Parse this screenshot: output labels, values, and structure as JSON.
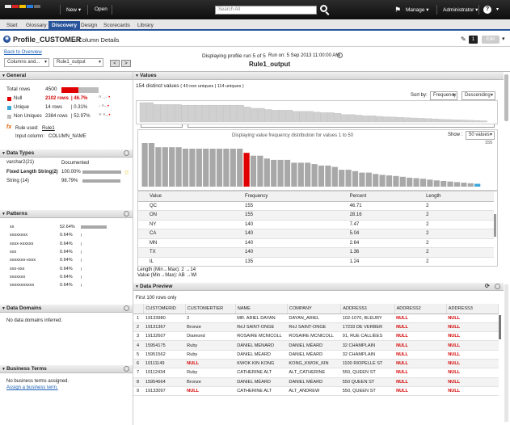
{
  "topbar": {
    "new_label": "New",
    "open_label": "Open",
    "search_placeholder": "Search All",
    "manage_label": "Manage",
    "user_label": "Administrator",
    "help_label": "?"
  },
  "tabs": [
    {
      "label": "Start"
    },
    {
      "label": "Glossary"
    },
    {
      "label": "Discovery"
    },
    {
      "label": "Design"
    },
    {
      "label": "Scorecards"
    },
    {
      "label": "Library"
    }
  ],
  "header": {
    "title": "Profile_CUSTOMER",
    "subtitle": "- Column Details",
    "badge": "1",
    "edit_label": "Edit"
  },
  "toolbar": {
    "back_link": "Back to Overview",
    "columns_select": "Columns and...",
    "column_select": "Rule1_output",
    "prev": "<",
    "next": ">",
    "run_info": "Displaying profile run 5 of 5",
    "run_date": "Run on: 5 Sep 2013 11:00:00 AM",
    "column_name": "Rule1_output"
  },
  "general": {
    "title": "General",
    "total_label": "Total rows",
    "total_value": "4500",
    "null_label": "Null",
    "null_rows": "2102 rows",
    "null_pct": "46.7%",
    "unique_label": "Unique",
    "unique_rows": "14 rows",
    "unique_pct": "0.31%",
    "nonunique_label": "Non Uniques",
    "nonunique_rows": "2384 rows",
    "nonunique_pct": "52.97%",
    "null_fraction": 0.467,
    "rule_label": "Rule used:",
    "rule_link": "Rule1",
    "input_label": "Input column:",
    "input_value": "COLUMN_NAME"
  },
  "data_types": {
    "title": "Data Types",
    "documented_label": "Documented",
    "rows": [
      {
        "name": "varchar2(21)",
        "pct": "",
        "fraction": 0
      },
      {
        "name": "Fixed Length String(2)",
        "pct": "100.00%",
        "fraction": 1.0
      },
      {
        "name": "String (14)",
        "pct": "98.79%",
        "fraction": 0.9879
      }
    ]
  },
  "patterns": {
    "title": "Patterns",
    "rows": [
      {
        "pattern": "xx",
        "pct": "52.64%",
        "fraction": 0.5264
      },
      {
        "pattern": "xxxxxxxx",
        "pct": "0.64%",
        "fraction": 0.0064
      },
      {
        "pattern": "xxxx-xxxxxx",
        "pct": "0.64%",
        "fraction": 0.0064
      },
      {
        "pattern": "xxx",
        "pct": "0.64%",
        "fraction": 0.0064
      },
      {
        "pattern": "xxxxxxx-xxxx",
        "pct": "0.64%",
        "fraction": 0.0064
      },
      {
        "pattern": "xxx-xxx",
        "pct": "0.64%",
        "fraction": 0.0064
      },
      {
        "pattern": "xxxxxxx",
        "pct": "0.64%",
        "fraction": 0.0064
      },
      {
        "pattern": "xxxxxxxxxxx",
        "pct": "0.64%",
        "fraction": 0.0064
      }
    ]
  },
  "data_domains": {
    "title": "Data Domains",
    "empty": "No data domains inferred."
  },
  "business_terms": {
    "title": "Business Terms",
    "empty": "No business terms assigned.",
    "assign_link": "Assign a business term."
  },
  "values": {
    "title": "Values",
    "distinct": "154 distinct values",
    "distinct_detail": "( 40 non uniques | 114 uniques )",
    "sort_label": "Sort by:",
    "sort_by": "Frequency",
    "sort_order": "Descending",
    "chart_caption": "Displaying value frequency distribution for values 1 to 50",
    "show_label": "Show :",
    "show_value": "50 values",
    "columns": [
      "Value",
      "Frequency",
      "Percent",
      "Length"
    ],
    "rows": [
      [
        "QC",
        "155",
        "46.71",
        "2"
      ],
      [
        "ON",
        "155",
        "28.16",
        "2"
      ],
      [
        "NY",
        "140",
        "7.47",
        "2"
      ],
      [
        "CA",
        "140",
        "5.04",
        "2"
      ],
      [
        "MN",
        "140",
        "2.64",
        "2"
      ],
      [
        "TX",
        "140",
        "1.36",
        "2"
      ],
      [
        "IL",
        "135",
        "1.24",
        "2"
      ]
    ],
    "length_info": "Length (Min→Max): 2 →14",
    "value_info": "Value  (Min→Max): AB →WI"
  },
  "chart_data": {
    "type": "bar",
    "ylim": [
      0,
      155
    ],
    "tick_max": "155",
    "highlight_index": 15,
    "values": [
      155,
      155,
      140,
      140,
      140,
      140,
      135,
      135,
      135,
      135,
      135,
      135,
      135,
      135,
      135,
      120,
      110,
      110,
      100,
      95,
      95,
      95,
      85,
      85,
      85,
      80,
      75,
      75,
      70,
      60,
      60,
      55,
      50,
      50,
      45,
      42,
      40,
      38,
      35,
      32,
      30,
      28,
      25,
      22,
      20,
      18,
      16,
      14,
      12,
      10
    ]
  },
  "data_preview": {
    "title": "Data Preview",
    "subtitle": "First 100 rows only",
    "columns": [
      "",
      "CUSTOMERID",
      "CUSTOMERTIER",
      "NAME",
      "COMPANY",
      "ADDRESS1",
      "ADDRESS2",
      "ADDRESS3"
    ],
    "rows": [
      [
        "1",
        "19133980",
        "2",
        "MR. ARIEL DAYAN",
        "DAYAN_ARIEL",
        "102-1070, BLEURY",
        "NULL",
        "NULL"
      ],
      [
        "2",
        "19131367",
        "Bronze",
        "RéJ SAINT-ONGE",
        "RéJ SAINT-ONGE",
        "17233 DE VERBER",
        "NULL",
        "NULL"
      ],
      [
        "3",
        "19132607",
        "Diamond",
        "ROSAIRE MCNICOLL",
        "ROSAIRE MCNICOLL",
        "91, RUE CALLIÈES",
        "NULL",
        "NULL"
      ],
      [
        "4",
        "15954175",
        "Ruby",
        "DANIEL MENARD",
        "DANIEL MÉARD",
        "32 CHAMPLAIN",
        "NULL",
        "NULL"
      ],
      [
        "5",
        "15951562",
        "Ruby",
        "DANIEL MÉARD",
        "DANIEL MÉARD",
        "32 CHAMPLAIN",
        "NULL",
        "NULL"
      ],
      [
        "6",
        "10111149",
        "NULL",
        "KWOK KIN KONG",
        "KONG_KWOK_KIN",
        "1100 RIOPELLE ST",
        "NULL",
        "NULL"
      ],
      [
        "7",
        "10112434",
        "Ruby",
        "CATHERINE ALT",
        "ALT_CATHERINE",
        "550, QUEEN ST",
        "NULL",
        "NULL"
      ],
      [
        "8",
        "15954664",
        "Bronze",
        "DANIEL MÉARD",
        "DANIEL MÉARD",
        "550 QUEEN ST",
        "NULL",
        "NULL"
      ],
      [
        "9",
        "19133097",
        "NULL",
        "CATHERINE ALT",
        "ALT_ANDREW",
        "550, QUEEN ST",
        "NULL",
        "NULL"
      ]
    ]
  },
  "colors": {
    "accent": "#27539b",
    "null_red": "#e00000",
    "bar_gray": "#a8a8a8",
    "highlight_red": "#e00000",
    "unique_blue": "#3aa7d8"
  }
}
